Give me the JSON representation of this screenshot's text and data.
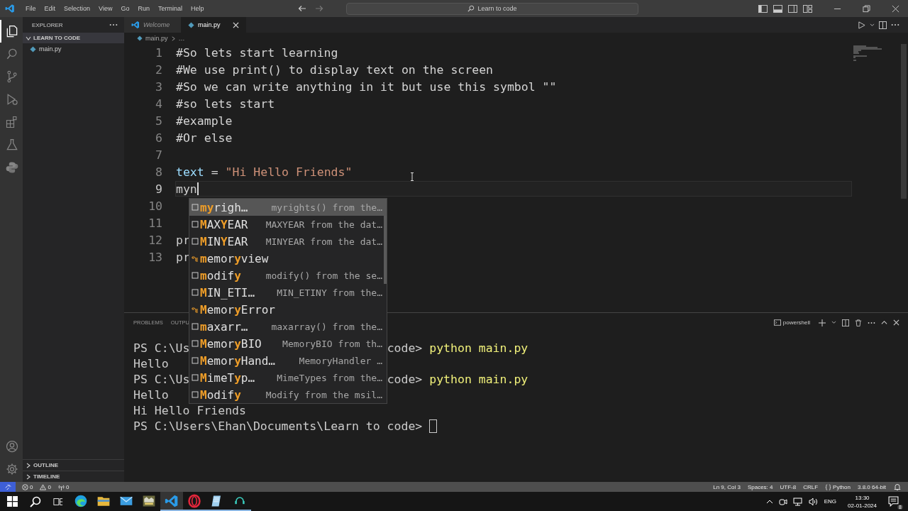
{
  "title_bar": {
    "menus": [
      "File",
      "Edit",
      "Selection",
      "View",
      "Go",
      "Run",
      "Terminal",
      "Help"
    ],
    "command_center": "Learn to code"
  },
  "activity_bar": {
    "items": [
      {
        "kind": "files",
        "selected": true
      },
      {
        "kind": "search",
        "selected": false
      },
      {
        "kind": "source-control",
        "selected": false
      },
      {
        "kind": "run",
        "selected": false
      },
      {
        "kind": "extensions",
        "selected": false
      },
      {
        "kind": "testing",
        "selected": false
      },
      {
        "kind": "python",
        "selected": false
      }
    ],
    "bottom": [
      {
        "kind": "account"
      },
      {
        "kind": "settings"
      }
    ]
  },
  "sidebar": {
    "title": "EXPLORER",
    "folder": {
      "name": "LEARN TO CODE",
      "expanded": true,
      "children": [
        {
          "name": "main.py"
        }
      ]
    },
    "sections": [
      {
        "name": "OUTLINE",
        "expanded": false
      },
      {
        "name": "TIMELINE",
        "expanded": false
      }
    ]
  },
  "tabs": [
    {
      "label": "Welcome",
      "kind": "welcome",
      "preview": true,
      "selected": false
    },
    {
      "label": "main.py",
      "kind": "python",
      "preview": false,
      "selected": true
    }
  ],
  "breadcrumb": [
    "main.py",
    "…"
  ],
  "editor": {
    "lines": [
      {
        "number": "1",
        "current": false,
        "tokens": [
          {
            "text": "#So lets start learning",
            "kind": "comment"
          }
        ]
      },
      {
        "number": "2",
        "current": false,
        "tokens": [
          {
            "text": "#We use print() to display text on the screen",
            "kind": "comment"
          }
        ]
      },
      {
        "number": "3",
        "current": false,
        "tokens": [
          {
            "text": "#So we can write anything in it but use this symbol \"\"",
            "kind": "comment"
          }
        ]
      },
      {
        "number": "4",
        "current": false,
        "tokens": [
          {
            "text": "#so lets start",
            "kind": "comment"
          }
        ]
      },
      {
        "number": "5",
        "current": false,
        "tokens": [
          {
            "text": "#example",
            "kind": "comment"
          }
        ]
      },
      {
        "number": "6",
        "current": false,
        "tokens": [
          {
            "text": "#Or else",
            "kind": "comment"
          }
        ]
      },
      {
        "number": "7",
        "current": false
      },
      {
        "number": "8",
        "current": false,
        "tokens": [
          {
            "text": "text",
            "kind": "variable"
          },
          {
            "text": " = ",
            "kind": "operator"
          },
          {
            "text": "\"Hi Hello Friends\"",
            "kind": "string"
          }
        ]
      },
      {
        "number": "9",
        "current": true,
        "tokens": [
          {
            "text": "myn",
            "kind": "plain"
          }
        ]
      },
      {
        "number": "10",
        "current": false
      },
      {
        "number": "11",
        "current": false
      },
      {
        "number": "12",
        "current": false,
        "tokens": [
          {
            "text": "pr",
            "kind": "plain"
          }
        ]
      },
      {
        "number": "13",
        "current": false,
        "tokens": [
          {
            "text": "pr",
            "kind": "plain"
          }
        ]
      }
    ]
  },
  "suggestions": {
    "items": [
      {
        "kind": "field",
        "selected": true,
        "parts": [
          {
            "text": "my",
            "match": true
          },
          {
            "text": "righ…",
            "match": false
          }
        ],
        "detail": "myrights() from the…"
      },
      {
        "kind": "field",
        "selected": false,
        "parts": [
          {
            "text": "M",
            "match": true
          },
          {
            "text": "AX",
            "match": false
          },
          {
            "text": "Y",
            "match": true
          },
          {
            "text": "EAR",
            "match": false
          }
        ],
        "detail": "MAXYEAR from the dat…"
      },
      {
        "kind": "field",
        "selected": false,
        "parts": [
          {
            "text": "M",
            "match": true
          },
          {
            "text": "IN",
            "match": false
          },
          {
            "text": "Y",
            "match": true
          },
          {
            "text": "EAR",
            "match": false
          }
        ],
        "detail": "MINYEAR from the dat…"
      },
      {
        "kind": "class",
        "selected": false,
        "parts": [
          {
            "text": "m",
            "match": true
          },
          {
            "text": "emor",
            "match": false
          },
          {
            "text": "y",
            "match": true
          },
          {
            "text": "view",
            "match": false
          }
        ]
      },
      {
        "kind": "field",
        "selected": false,
        "parts": [
          {
            "text": "m",
            "match": true
          },
          {
            "text": "odif",
            "match": false
          },
          {
            "text": "y",
            "match": true
          }
        ],
        "detail": "modify() from the se…"
      },
      {
        "kind": "field",
        "selected": false,
        "parts": [
          {
            "text": "M",
            "match": true
          },
          {
            "text": "IN_ETI…",
            "match": false
          }
        ],
        "detail": "MIN_ETINY from the…"
      },
      {
        "kind": "class",
        "selected": false,
        "parts": [
          {
            "text": "M",
            "match": true
          },
          {
            "text": "emor",
            "match": false
          },
          {
            "text": "y",
            "match": true
          },
          {
            "text": "Error",
            "match": false
          }
        ]
      },
      {
        "kind": "field",
        "selected": false,
        "parts": [
          {
            "text": "m",
            "match": true
          },
          {
            "text": "axarr…",
            "match": false
          }
        ],
        "detail": "maxarray() from the…"
      },
      {
        "kind": "field",
        "selected": false,
        "parts": [
          {
            "text": "M",
            "match": true
          },
          {
            "text": "emor",
            "match": false
          },
          {
            "text": "y",
            "match": true
          },
          {
            "text": "BIO",
            "match": false
          }
        ],
        "detail": "MemoryBIO from th…"
      },
      {
        "kind": "field",
        "selected": false,
        "parts": [
          {
            "text": "M",
            "match": true
          },
          {
            "text": "emor",
            "match": false
          },
          {
            "text": "y",
            "match": true
          },
          {
            "text": "Hand…",
            "match": false
          }
        ],
        "detail": "MemoryHandler …"
      },
      {
        "kind": "field",
        "selected": false,
        "parts": [
          {
            "text": "M",
            "match": true
          },
          {
            "text": "imeT",
            "match": false
          },
          {
            "text": "y",
            "match": true
          },
          {
            "text": "p…",
            "match": false
          }
        ],
        "detail": "MimeTypes from the…"
      },
      {
        "kind": "field",
        "selected": false,
        "parts": [
          {
            "text": "M",
            "match": true
          },
          {
            "text": "odif",
            "match": false
          },
          {
            "text": "y",
            "match": true
          }
        ],
        "detail": "Modify from the msil…"
      }
    ]
  },
  "panel": {
    "tabs": [
      {
        "label": "PROBLEMS",
        "selected": false
      },
      {
        "label": "OUTPU",
        "selected": false
      }
    ],
    "terminal_name": "powershell",
    "lines": [
      {
        "kind": "split",
        "left": "PS C:\\Us",
        "right": "code>",
        "command": "python main.py"
      },
      {
        "kind": "output",
        "text": "Hello"
      },
      {
        "kind": "split",
        "left": "PS C:\\Us",
        "right": "code>",
        "command": "python main.py"
      },
      {
        "kind": "output",
        "text": "Hello"
      },
      {
        "kind": "output",
        "text": "Hi Hello Friends"
      },
      {
        "kind": "prompt",
        "text": "PS C:\\Users\\Ehan\\Documents\\Learn to code>",
        "cursor": true
      }
    ]
  },
  "status_bar": {
    "left": [
      {
        "kind": "errors",
        "text": "0"
      },
      {
        "kind": "warnings",
        "text": "0"
      },
      {
        "kind": "ports",
        "text": "0"
      }
    ],
    "right": [
      {
        "kind": "text",
        "text": "Ln 9, Col 3"
      },
      {
        "kind": "text",
        "text": "Spaces: 4"
      },
      {
        "kind": "text",
        "text": "UTF-8"
      },
      {
        "kind": "text",
        "text": "CRLF"
      },
      {
        "kind": "language",
        "text": "Python"
      },
      {
        "kind": "text",
        "text": "3.8.0 64-bit"
      },
      {
        "kind": "bell"
      }
    ]
  },
  "taskbar": {
    "apps": [
      {
        "kind": "browser",
        "running": false,
        "selected": false
      },
      {
        "kind": "files",
        "running": false,
        "selected": false
      },
      {
        "kind": "mail",
        "running": false,
        "selected": false
      },
      {
        "kind": "game",
        "running": false,
        "selected": false
      },
      {
        "kind": "editor",
        "running": true,
        "selected": true
      },
      {
        "kind": "ring",
        "running": true,
        "selected": false
      },
      {
        "kind": "notepad",
        "running": true,
        "selected": false
      },
      {
        "kind": "app",
        "running": true,
        "selected": false
      }
    ],
    "language": "ENG",
    "time": "13:30",
    "date": "02-01-2024",
    "notifications": "8"
  }
}
